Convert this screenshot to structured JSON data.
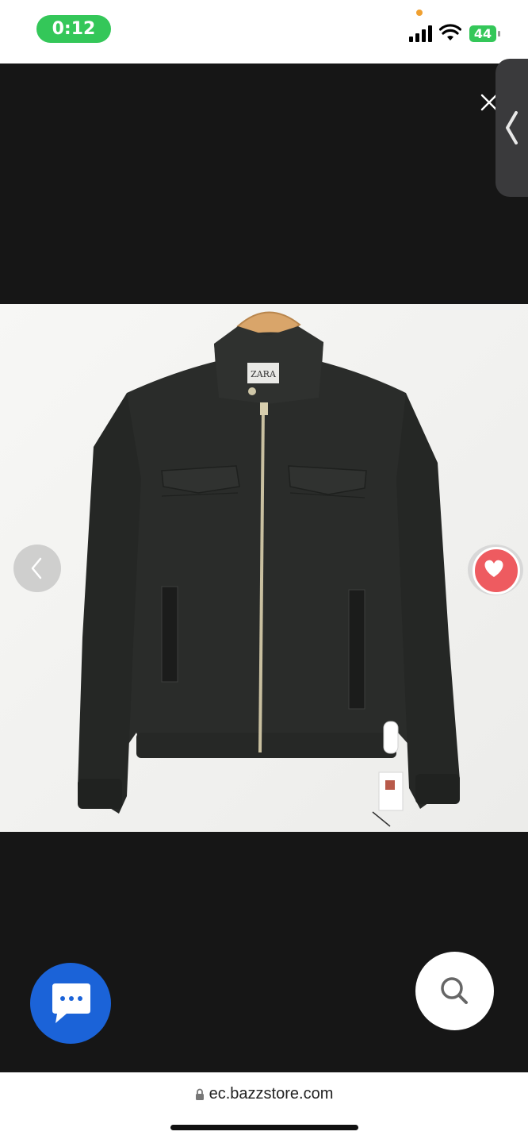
{
  "status_bar": {
    "time": "0:12",
    "battery_level": "44"
  },
  "viewer": {
    "product_image_alt": "ZARA",
    "icons": {
      "close": "close-icon",
      "side_tab": "chevron-left-icon",
      "prev": "chevron-left-icon",
      "favorite": "heart-icon",
      "chat": "chat-bubble-icon",
      "search": "search-icon"
    }
  },
  "browser": {
    "url": "ec.bazzstore.com"
  },
  "colors": {
    "status_green": "#34c759",
    "favorite_red": "#ee5b60",
    "chat_blue": "#1b63d8",
    "viewer_bg": "#161616"
  }
}
